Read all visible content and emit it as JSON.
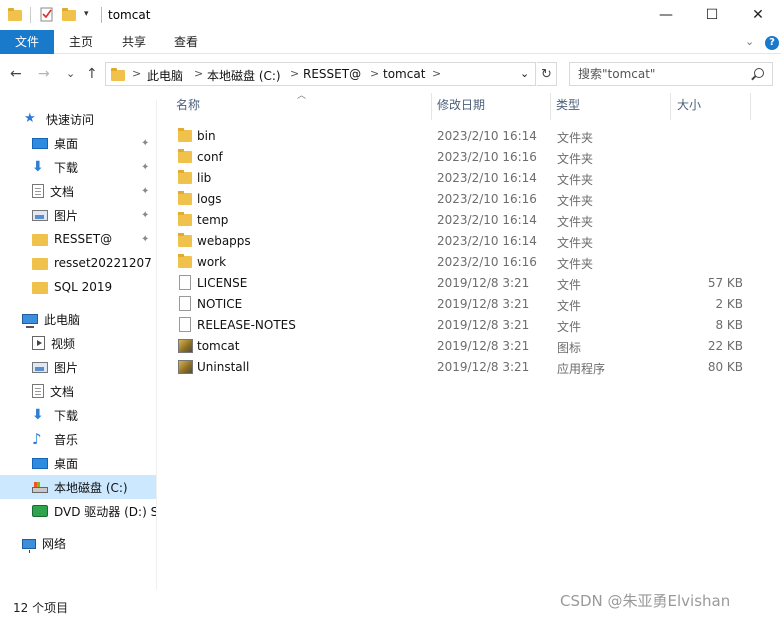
{
  "window": {
    "title": "tomcat",
    "minimize_glyph": "—",
    "maximize_glyph": "☐",
    "close_glyph": "✕"
  },
  "ribbon": {
    "tabs": [
      {
        "label": "文件",
        "active": true
      },
      {
        "label": "主页",
        "active": false
      },
      {
        "label": "共享",
        "active": false
      },
      {
        "label": "查看",
        "active": false
      }
    ],
    "collapse_glyph": "⌄",
    "help_glyph": "?"
  },
  "address": {
    "back_glyph": "←",
    "forward_glyph": "→",
    "recent_glyph": "⌄",
    "up_glyph": "↑",
    "path": [
      "此电脑",
      "本地磁盘 (C:)",
      "RESSET@",
      "tomcat"
    ],
    "separator_glyph": ">",
    "dropdown_glyph": "⌄",
    "refresh_glyph": "↻"
  },
  "search": {
    "placeholder": "搜索\"tomcat\""
  },
  "sidebar": {
    "quick_access": {
      "label": "快速访问",
      "icon": "star-icon"
    },
    "quick_items": [
      {
        "label": "桌面",
        "icon": "desktop-icon",
        "pinned": true
      },
      {
        "label": "下载",
        "icon": "download-icon",
        "pinned": true
      },
      {
        "label": "文档",
        "icon": "document-icon",
        "pinned": true
      },
      {
        "label": "图片",
        "icon": "pictures-icon",
        "pinned": true
      },
      {
        "label": "RESSET@",
        "icon": "folder-icon",
        "pinned": true
      },
      {
        "label": "resset20221207",
        "icon": "folder-icon",
        "pinned": false
      },
      {
        "label": "SQL 2019",
        "icon": "folder-icon",
        "pinned": false
      }
    ],
    "this_pc": {
      "label": "此电脑",
      "icon": "computer-icon"
    },
    "pc_items": [
      {
        "label": "视频",
        "icon": "video-icon"
      },
      {
        "label": "图片",
        "icon": "pictures-icon"
      },
      {
        "label": "文档",
        "icon": "document-icon"
      },
      {
        "label": "下载",
        "icon": "download-icon"
      },
      {
        "label": "音乐",
        "icon": "music-icon"
      },
      {
        "label": "桌面",
        "icon": "desktop-icon"
      },
      {
        "label": "本地磁盘 (C:)",
        "icon": "drive-icon"
      },
      {
        "label": "DVD 驱动器 (D:) S",
        "icon": "dvd-icon"
      }
    ],
    "network": {
      "label": "网络",
      "icon": "network-icon"
    },
    "pin_glyph": "📌"
  },
  "columns": {
    "name": "名称",
    "date": "修改日期",
    "type": "类型",
    "size": "大小"
  },
  "files": [
    {
      "name": "bin",
      "date": "2023/2/10 16:14",
      "type": "文件夹",
      "size": "",
      "icon": "folder"
    },
    {
      "name": "conf",
      "date": "2023/2/10 16:16",
      "type": "文件夹",
      "size": "",
      "icon": "folder"
    },
    {
      "name": "lib",
      "date": "2023/2/10 16:14",
      "type": "文件夹",
      "size": "",
      "icon": "folder"
    },
    {
      "name": "logs",
      "date": "2023/2/10 16:16",
      "type": "文件夹",
      "size": "",
      "icon": "folder"
    },
    {
      "name": "temp",
      "date": "2023/2/10 16:14",
      "type": "文件夹",
      "size": "",
      "icon": "folder"
    },
    {
      "name": "webapps",
      "date": "2023/2/10 16:14",
      "type": "文件夹",
      "size": "",
      "icon": "folder"
    },
    {
      "name": "work",
      "date": "2023/2/10 16:16",
      "type": "文件夹",
      "size": "",
      "icon": "folder"
    },
    {
      "name": "LICENSE",
      "date": "2019/12/8 3:21",
      "type": "文件",
      "size": "57 KB",
      "icon": "file"
    },
    {
      "name": "NOTICE",
      "date": "2019/12/8 3:21",
      "type": "文件",
      "size": "2 KB",
      "icon": "file"
    },
    {
      "name": "RELEASE-NOTES",
      "date": "2019/12/8 3:21",
      "type": "文件",
      "size": "8 KB",
      "icon": "file"
    },
    {
      "name": "tomcat",
      "date": "2019/12/8 3:21",
      "type": "图标",
      "size": "22 KB",
      "icon": "app"
    },
    {
      "name": "Uninstall",
      "date": "2019/12/8 3:21",
      "type": "应用程序",
      "size": "80 KB",
      "icon": "app"
    }
  ],
  "status": {
    "item_count": "12 个项目"
  },
  "watermark": "CSDN @朱亚勇Elvishan",
  "colors": {
    "accent": "#1979ca",
    "folder": "#f0c24c",
    "selected": "#cce8ff"
  }
}
